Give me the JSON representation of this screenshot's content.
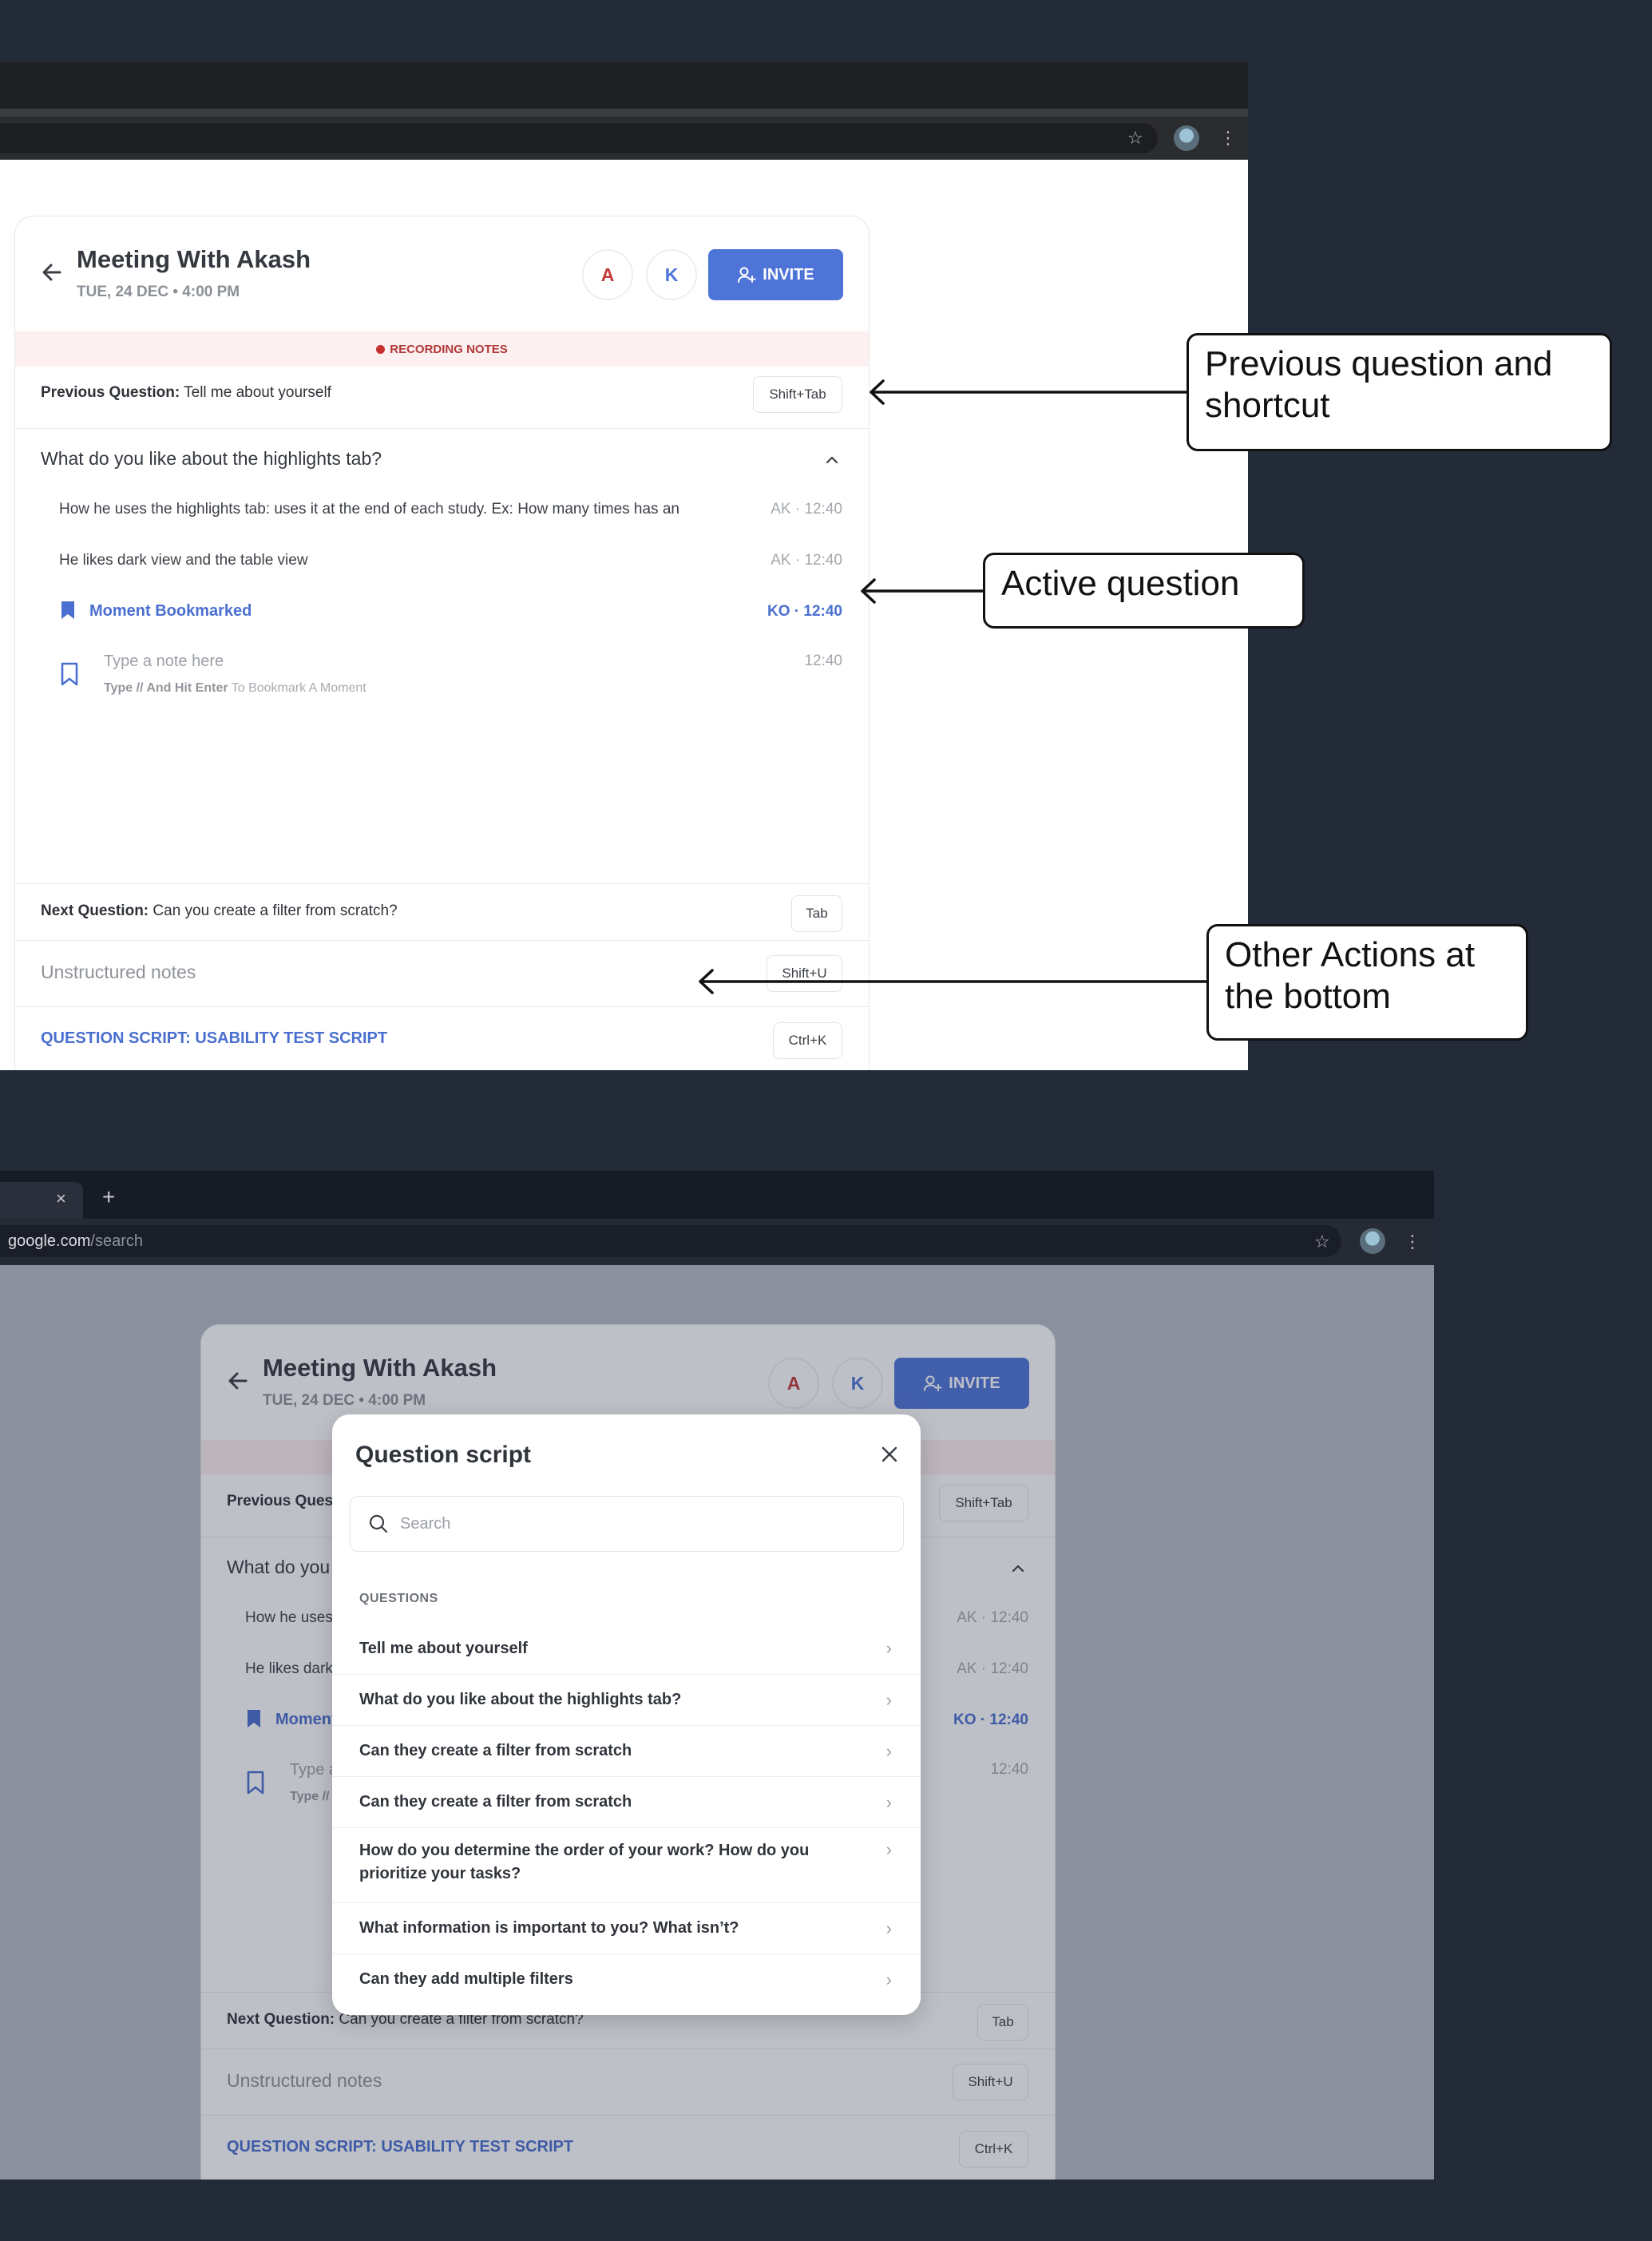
{
  "meeting": {
    "title": "Meeting With Akash",
    "datetime": "TUE, 24 DEC • 4:00 PM",
    "participants": [
      "A",
      "K"
    ],
    "invite_label": "INVITE",
    "recording_label": "RECORDING NOTES",
    "previous_question": {
      "label": "Previous Question:",
      "text": "Tell me about yourself",
      "shortcut": "Shift+Tab"
    },
    "active_question": {
      "title": "What do you like about the highlights tab?",
      "notes": [
        {
          "text": "How he uses the highlights tab: uses it at the end of each study. Ex: How many times has an",
          "meta": "AK · 12:40"
        },
        {
          "text": "He likes dark view and the table view",
          "meta": "AK · 12:40"
        }
      ],
      "bookmark": {
        "text": "Moment Bookmarked",
        "meta": "KO · 12:40"
      },
      "input": {
        "placeholder": "Type a note here",
        "time": "12:40",
        "hint_bold": "Type // And Hit Enter",
        "hint_rest": "To Bookmark A Moment"
      }
    },
    "next_question": {
      "label": "Next Question:",
      "text": "Can you create a filter from scratch?",
      "shortcut": "Tab"
    },
    "unstructured": {
      "label": "Unstructured notes",
      "shortcut": "Shift+U"
    },
    "script": {
      "label": "QUESTION SCRIPT: USABILITY TEST SCRIPT",
      "shortcut": "Ctrl+K"
    }
  },
  "callouts": {
    "previous": "Previous question and shortcut",
    "active": "Active question",
    "other": "Other Actions at the bottom"
  },
  "browser2": {
    "url_domain": "google.com",
    "url_path": "/search",
    "tab_close": "×",
    "new_tab": "+"
  },
  "modal": {
    "title": "Question script",
    "search_placeholder": "Search",
    "section_label": "QUESTIONS",
    "questions": [
      "Tell me about yourself",
      "What do you like about the highlights tab?",
      "Can they create a filter from scratch",
      "Can they create a filter from scratch",
      "How do you determine the order of your work? How do you prioritize your tasks?",
      "What information is important to you? What isn’t?",
      "Can they add multiple filters"
    ]
  },
  "icons": {
    "back": "arrow-left",
    "invite": "user-plus",
    "bookmark_filled": "bookmark-filled",
    "bookmark_outline": "bookmark-outline",
    "chevron_up": "chevron-up",
    "star": "star",
    "menu": "kebab",
    "close": "close",
    "search": "search",
    "chevron_right": "chevron-right"
  },
  "colors": {
    "background": "#232b38",
    "accent": "#4e74d8",
    "recording_bg": "#fdf0f0",
    "recording_text": "#b13838",
    "participant_a": "#c33a3a",
    "participant_k": "#4e74d8",
    "overlay": "#b6bac5"
  }
}
